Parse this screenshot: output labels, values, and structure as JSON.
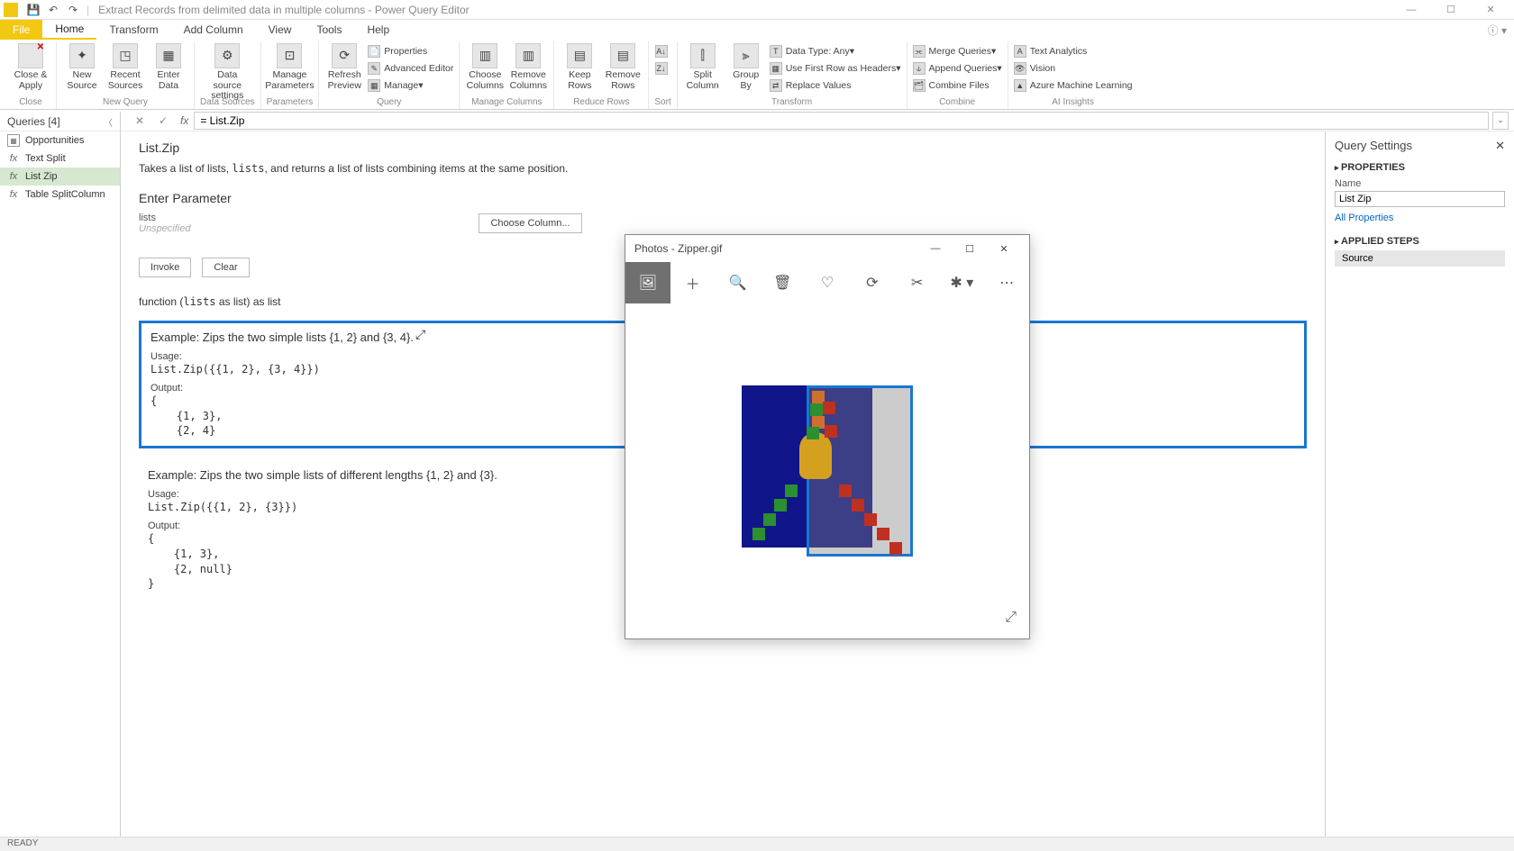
{
  "titlebar": {
    "title": "Extract Records from delimited data in multiple columns - Power Query Editor"
  },
  "win_controls": {
    "min": "—",
    "max": "☐",
    "close": "✕"
  },
  "menu": {
    "file": "File",
    "tabs": [
      "Home",
      "Transform",
      "Add Column",
      "View",
      "Tools",
      "Help"
    ],
    "active": "Home"
  },
  "ribbon": {
    "close": {
      "btn": "Close &\nApply",
      "group": "Close"
    },
    "new_query": {
      "new_source": "New\nSource",
      "recent_sources": "Recent\nSources",
      "enter_data": "Enter\nData",
      "group": "New Query"
    },
    "data_sources": {
      "btn": "Data source\nsettings",
      "group": "Data Sources"
    },
    "parameters": {
      "btn": "Manage\nParameters",
      "group": "Parameters"
    },
    "query": {
      "refresh": "Refresh\nPreview",
      "properties": "Properties",
      "advanced": "Advanced Editor",
      "manage": "Manage",
      "group": "Query"
    },
    "manage_cols": {
      "choose": "Choose\nColumns",
      "remove": "Remove\nColumns",
      "group": "Manage Columns"
    },
    "reduce_rows": {
      "keep": "Keep\nRows",
      "remove": "Remove\nRows",
      "group": "Reduce Rows"
    },
    "sort": {
      "group": "Sort"
    },
    "transform": {
      "split": "Split\nColumn",
      "groupby": "Group\nBy",
      "datatype": "Data Type: Any",
      "firstrow": "Use First Row as Headers",
      "replace": "Replace Values",
      "group": "Transform"
    },
    "combine": {
      "merge": "Merge Queries",
      "append": "Append Queries",
      "combine_files": "Combine Files",
      "group": "Combine"
    },
    "ai": {
      "text": "Text Analytics",
      "vision": "Vision",
      "aml": "Azure Machine Learning",
      "group": "AI Insights"
    }
  },
  "formula": {
    "value": "= List.Zip"
  },
  "queries": {
    "header": "Queries [4]",
    "items": [
      {
        "name": "Opportunities",
        "type": "table"
      },
      {
        "name": "Text Split",
        "type": "fx"
      },
      {
        "name": "List Zip",
        "type": "fx",
        "selected": true
      },
      {
        "name": "Table SplitColumn",
        "type": "fx"
      }
    ]
  },
  "content": {
    "fn_name": "List.Zip",
    "fn_desc_pre": "Takes a list of lists, ",
    "fn_desc_code": "lists",
    "fn_desc_post": ", and returns a list of lists combining items at the same position.",
    "enter_param": "Enter Parameter",
    "param_name": "lists",
    "param_unspec": "Unspecified",
    "choose_col": "Choose Column...",
    "invoke": "Invoke",
    "clear": "Clear",
    "sig_pre": "function (",
    "sig_code": "lists",
    "sig_post": " as list) as list",
    "ex1": {
      "title": "Example: Zips the two simple lists {1, 2} and {3, 4}.",
      "usage_lbl": "Usage:",
      "usage": "List.Zip({{1, 2}, {3, 4}})",
      "output_lbl": "Output:",
      "output": "{\n    {1, 3},\n    {2, 4}"
    },
    "ex2": {
      "title": "Example: Zips the two simple lists of different lengths {1, 2} and {3}.",
      "usage_lbl": "Usage:",
      "usage": "List.Zip({{1, 2}, {3}})",
      "output_lbl": "Output:",
      "output": "{\n    {1, 3},\n    {2, null}\n}"
    }
  },
  "settings": {
    "header": "Query Settings",
    "properties": "PROPERTIES",
    "name_lbl": "Name",
    "name_val": "List Zip",
    "all_props": "All Properties",
    "applied_steps": "APPLIED STEPS",
    "step1": "Source"
  },
  "photos": {
    "title": "Photos - Zipper.gif",
    "toolbar_icons": [
      "image",
      "add",
      "zoom",
      "delete",
      "heart",
      "rotate",
      "crop",
      "edit",
      "more"
    ]
  },
  "status": {
    "ready": "READY"
  }
}
